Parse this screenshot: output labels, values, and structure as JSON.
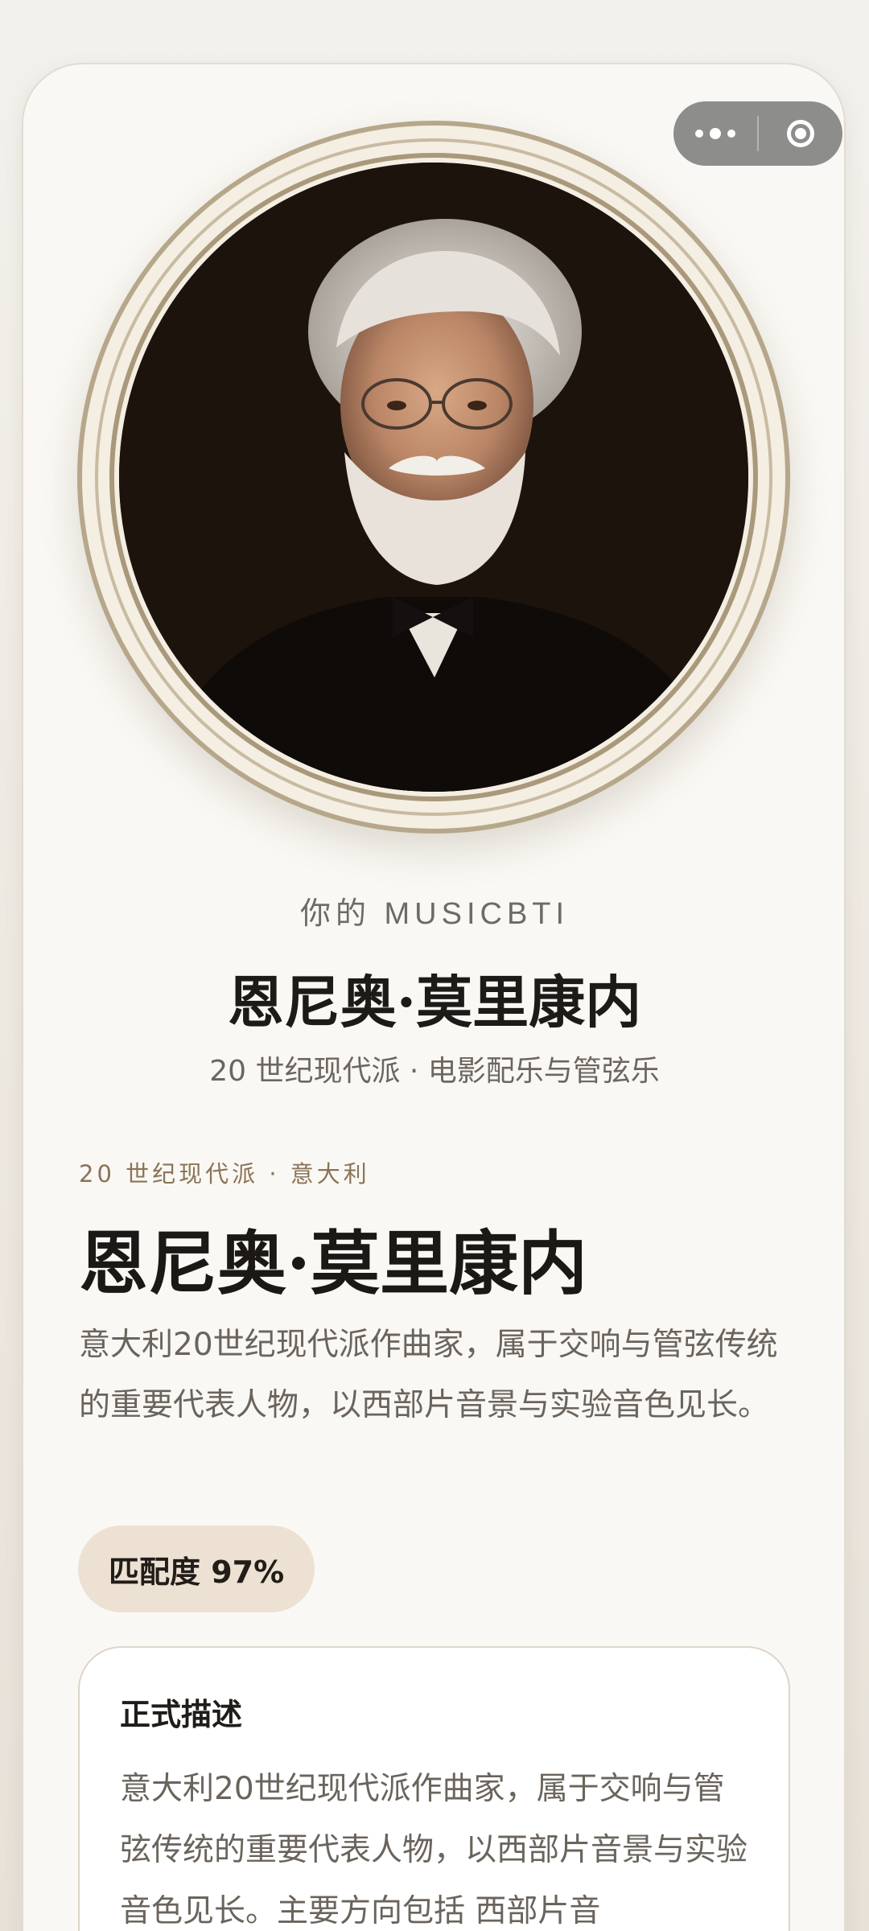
{
  "capsule": {
    "more_icon": "more-dots-icon",
    "close_icon": "close-target-icon"
  },
  "portrait": {
    "alt": "composer-portrait"
  },
  "hero": {
    "eyebrow": "你的 MUSICBTI",
    "name": "恩尼奥·莫里康内",
    "subtitle": "20 世纪现代派 · 电影配乐与管弦乐"
  },
  "profile": {
    "meta": "20 世纪现代派 · 意大利",
    "name": "恩尼奥·莫里康内",
    "intro": "意大利20世纪现代派作曲家，属于交响与管弦传统的重要代表人物，以西部片音景与实验音色见长。",
    "match_label": "匹配度 97%"
  },
  "description": {
    "title": "正式描述",
    "body": "意大利20世纪现代派作曲家，属于交响与管弦传统的重要代表人物，以西部片音景与实验音色见长。主要方向包括 西部片音"
  },
  "colors": {
    "accent": "#8a7456",
    "frame": "#b6a78b",
    "pill": "#ece1d3"
  }
}
